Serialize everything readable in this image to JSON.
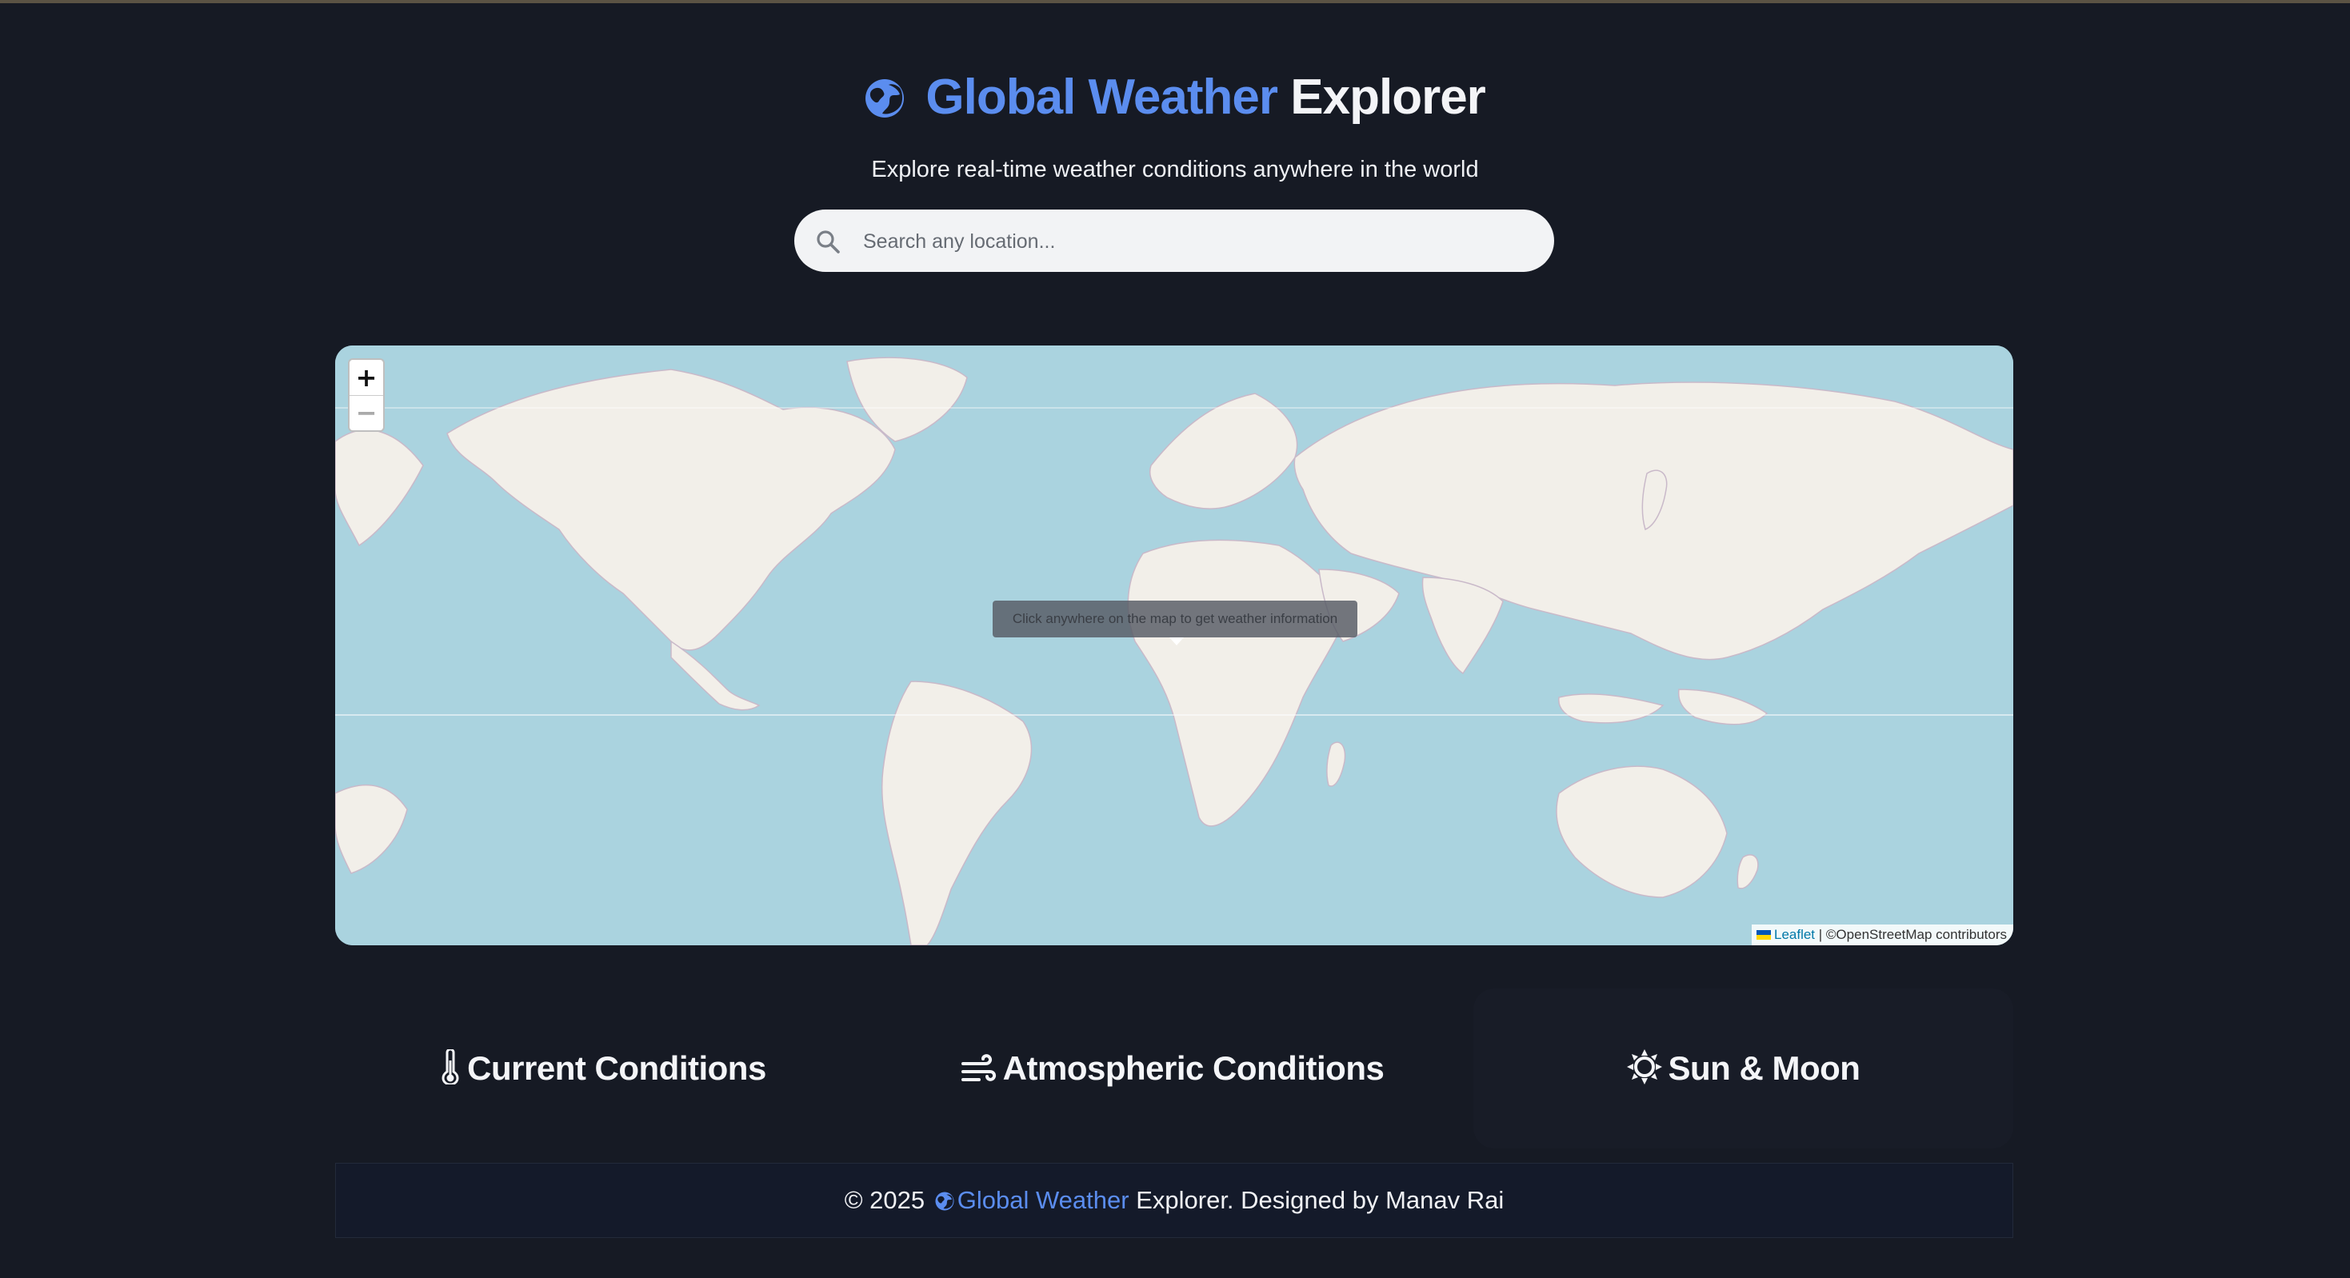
{
  "header": {
    "title_accent": "Global Weather",
    "title_rest": "Explorer",
    "subtitle": "Explore real-time weather conditions anywhere in the world",
    "globe_icon": "globe-icon"
  },
  "search": {
    "placeholder": "Search any location...",
    "value": "",
    "icon": "search-icon"
  },
  "map": {
    "zoom_in_label": "+",
    "zoom_out_label": "−",
    "tooltip": "Click anywhere on the map to get weather information",
    "attribution_link": "Leaflet",
    "attribution_text": "| ©OpenStreetMap contributors"
  },
  "sections": [
    {
      "label": "Current Conditions",
      "icon": "thermometer-icon"
    },
    {
      "label": "Atmospheric Conditions",
      "icon": "wind-icon"
    },
    {
      "label": "Sun & Moon",
      "icon": "sun-icon"
    }
  ],
  "footer": {
    "prefix": "© 2025",
    "accent": "Global Weather",
    "suffix": "Explorer. Designed by Manav Rai"
  },
  "colors": {
    "background": "#161a24",
    "accent": "#5b8def",
    "ocean": "#aad3df",
    "land": "#f2efe9"
  }
}
